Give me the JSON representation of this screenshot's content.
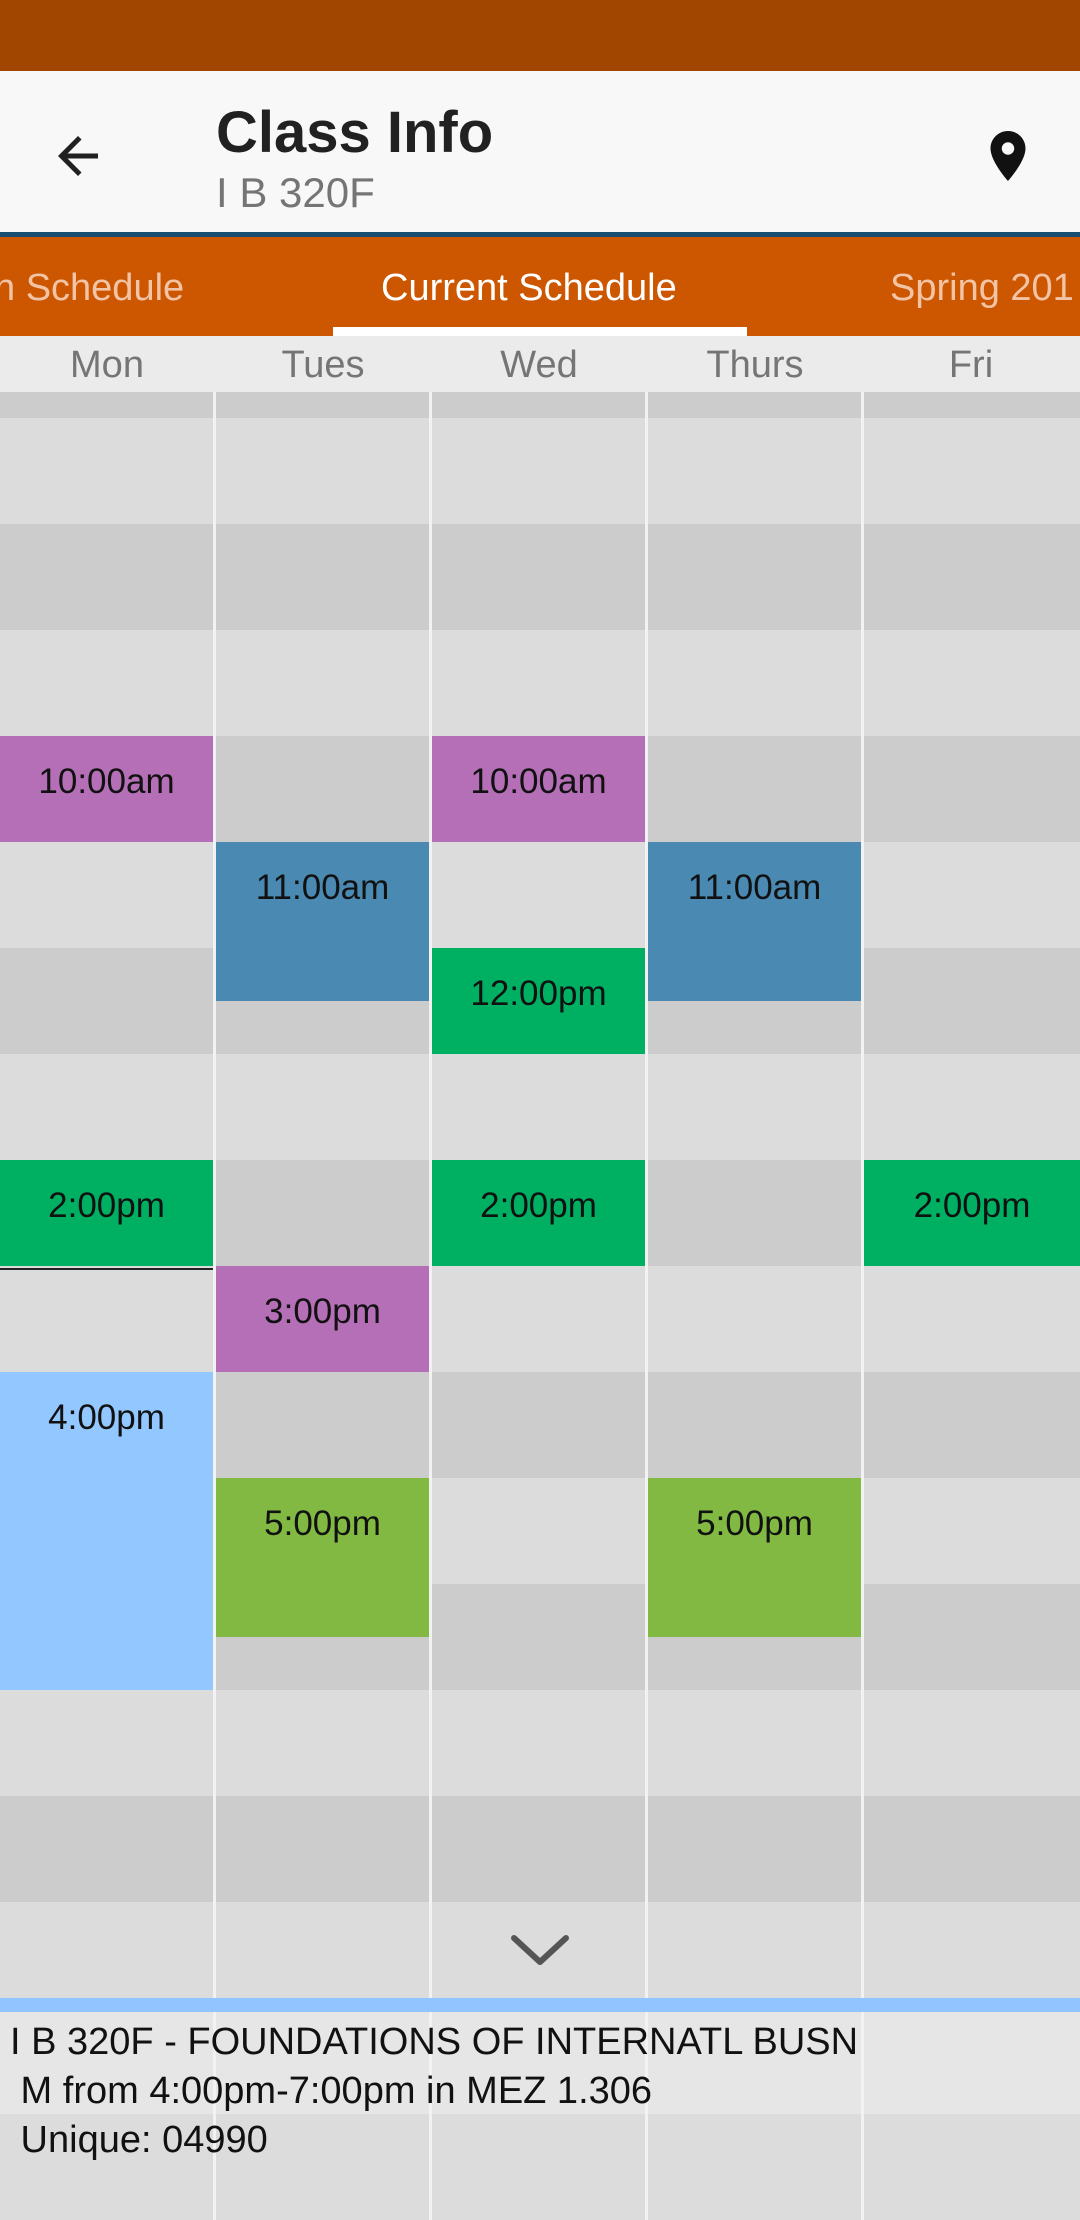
{
  "app_bar": {
    "title": "Class Info",
    "subtitle": "I B 320F",
    "back_icon": "arrow-left-icon",
    "location_icon": "map-pin-icon"
  },
  "tabs": [
    {
      "label": "n Schedule",
      "active": false
    },
    {
      "label": "Current Schedule",
      "active": true
    },
    {
      "label": "Spring 201",
      "active": false
    }
  ],
  "days": [
    "Mon",
    "Tues",
    "Wed",
    "Thurs",
    "Fri"
  ],
  "events": {
    "mon_10": "10:00am",
    "mon_2": "2:00pm",
    "mon_4": "4:00pm",
    "tue_11": "11:00am",
    "tue_3": "3:00pm",
    "tue_5": "5:00pm",
    "wed_10": "10:00am",
    "wed_12": "12:00pm",
    "wed_2": "2:00pm",
    "thu_11": "11:00am",
    "thu_5": "5:00pm",
    "fri_2": "2:00pm"
  },
  "colors": {
    "purple": "#b46fb6",
    "blue": "#4a8ab2",
    "green": "#00b062",
    "light_green": "#82b943",
    "light_blue": "#93c7ff",
    "status_bar": "#a14600",
    "tab_bar": "#cd5700"
  },
  "info": {
    "line1": "I B 320F - FOUNDATIONS OF INTERNATL BUSN",
    "line2": " M from 4:00pm-7:00pm in MEZ 1.306",
    "line3": " Unique: 04990"
  },
  "scroll_icon": "chevron-down-icon"
}
